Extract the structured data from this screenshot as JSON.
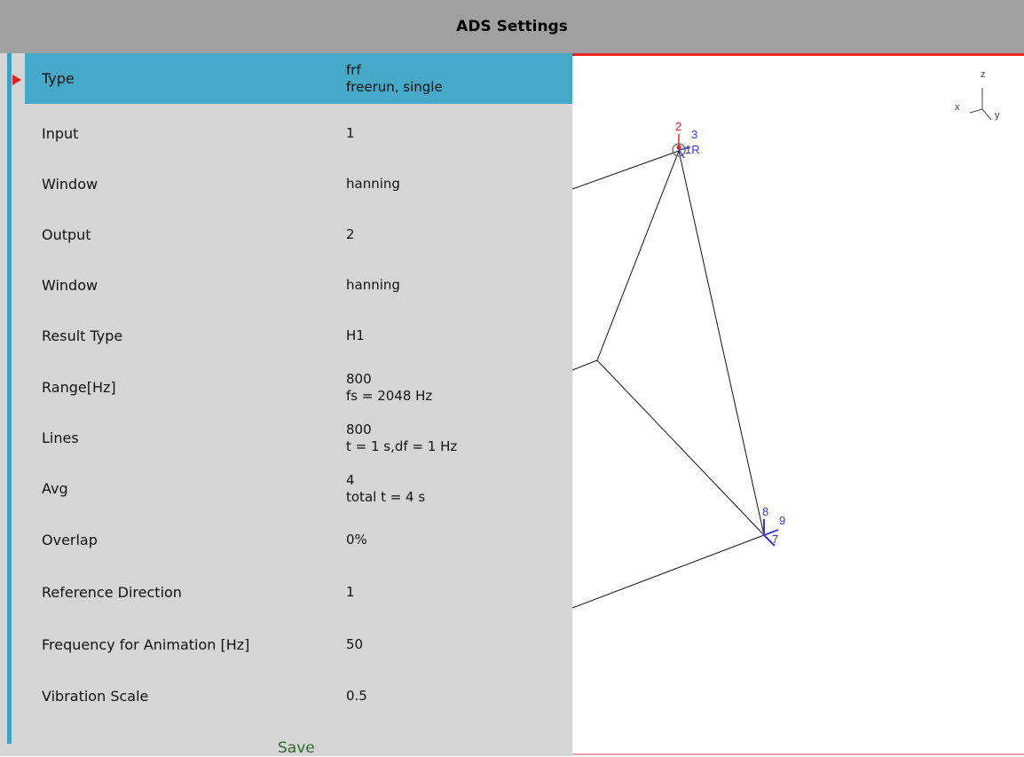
{
  "title": "ADS Settings",
  "settings": [
    {
      "label": "Type",
      "values": [
        "frf",
        "freerun, single"
      ]
    },
    {
      "label": "Input",
      "values": [
        "1"
      ]
    },
    {
      "label": "Window",
      "values": [
        "hanning"
      ]
    },
    {
      "label": "Output",
      "values": [
        "2"
      ]
    },
    {
      "label": "Window",
      "values": [
        "hanning"
      ]
    },
    {
      "label": "Result Type",
      "values": [
        "H1"
      ]
    },
    {
      "label": "Range[Hz]",
      "values": [
        "800",
        "fs = 2048 Hz"
      ]
    },
    {
      "label": "Lines",
      "values": [
        "800",
        "t = 1 s,df = 1 Hz"
      ]
    },
    {
      "label": "Avg",
      "values": [
        "4",
        "total t = 4 s"
      ]
    },
    {
      "label": "Overlap",
      "values": [
        "0%"
      ]
    },
    {
      "label": "Reference Direction",
      "values": [
        "1"
      ]
    },
    {
      "label": "Frequency for Animation [Hz]",
      "values": [
        "50"
      ]
    },
    {
      "label": "Vibration Scale",
      "values": [
        "0.5"
      ]
    }
  ],
  "save_label": "Save",
  "axes": {
    "x": "x",
    "y": "y",
    "z": "z"
  },
  "points": {
    "p2": "2",
    "p3": "3",
    "p1r": "1R",
    "p8": "8",
    "p9": "9",
    "p7": "7"
  },
  "colors": {
    "title_bg": "#a0a0a0",
    "panel_bg": "#d5d5d5",
    "selected_bg": "#46a9c7",
    "accent_red": "#e8242b",
    "node_blue": "#3a3ac8"
  }
}
